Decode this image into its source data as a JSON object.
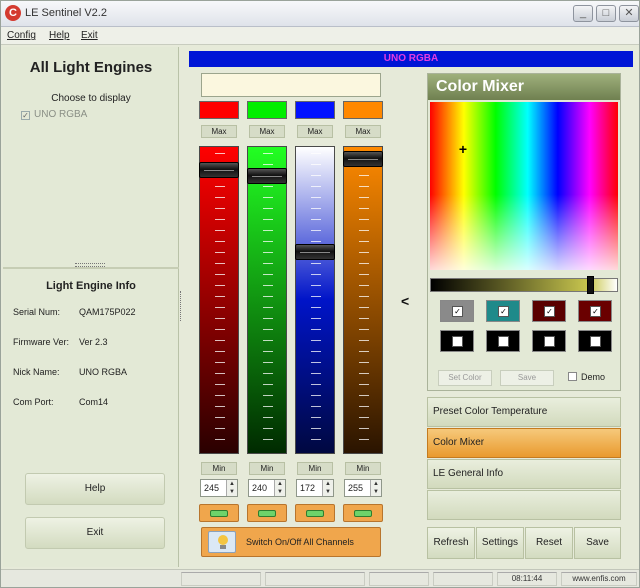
{
  "window": {
    "title": "LE Sentinel V2.2",
    "app_icon": "C"
  },
  "menu": {
    "items": [
      "Config",
      "Help",
      "Exit"
    ]
  },
  "left_panel": {
    "title": "All Light Engines",
    "choose_label": "Choose to display",
    "engine_checkbox": "UNO RGBA",
    "info_title": "Light Engine Info",
    "info": [
      {
        "label": "Serial Num:",
        "value": "QAM175P022"
      },
      {
        "label": "Firmware Ver:",
        "value": "Ver 2.3"
      },
      {
        "label": "Nick Name:",
        "value": "UNO RGBA"
      },
      {
        "label": "Com Port:",
        "value": "Com14"
      }
    ],
    "help_button": "Help",
    "exit_button": "Exit"
  },
  "device_header": "UNO RGBA",
  "channels": [
    {
      "color": "#ff0000",
      "max_label": "Max",
      "min_label": "Min",
      "value": "245",
      "level": 0.96,
      "track_gradient": [
        "#ff0000",
        "#2a0000"
      ]
    },
    {
      "color": "#00ee00",
      "max_label": "Max",
      "min_label": "Min",
      "value": "240",
      "level": 0.94,
      "track_gradient": [
        "#22ff22",
        "#002a00"
      ]
    },
    {
      "color": "#0010ff",
      "max_label": "Max",
      "min_label": "Min",
      "value": "172",
      "level": 0.67,
      "track_gradient": [
        "#ffffff",
        "#0014c8",
        "#000840"
      ]
    },
    {
      "color": "#ff8800",
      "max_label": "Max",
      "min_label": "Min",
      "value": "255",
      "level": 1.0,
      "track_gradient": [
        "#ff8a00",
        "#2a1400"
      ]
    }
  ],
  "switch_all_label": "Switch On/Off All Channels",
  "collapse_glyph": "<",
  "mixer": {
    "title": "Color Mixer",
    "presets_row1": [
      "#8a8a8a",
      "#1f8a8a",
      "#5a0000",
      "#6a0000"
    ],
    "presets_row2": [
      "#000000",
      "#000000",
      "#000000",
      "#000000"
    ],
    "set_color_label": "Set Color",
    "save_label": "Save",
    "demo_label": "Demo"
  },
  "accordion": [
    {
      "label": "Preset Color Temperature",
      "active": false
    },
    {
      "label": "Color Mixer",
      "active": true
    },
    {
      "label": "LE General Info",
      "active": false
    },
    {
      "label": "",
      "active": false
    }
  ],
  "bottom_buttons": [
    "Refresh",
    "Settings",
    "Reset",
    "Save"
  ],
  "status": {
    "time": "08:11:44",
    "site": "www.enfis.com"
  }
}
